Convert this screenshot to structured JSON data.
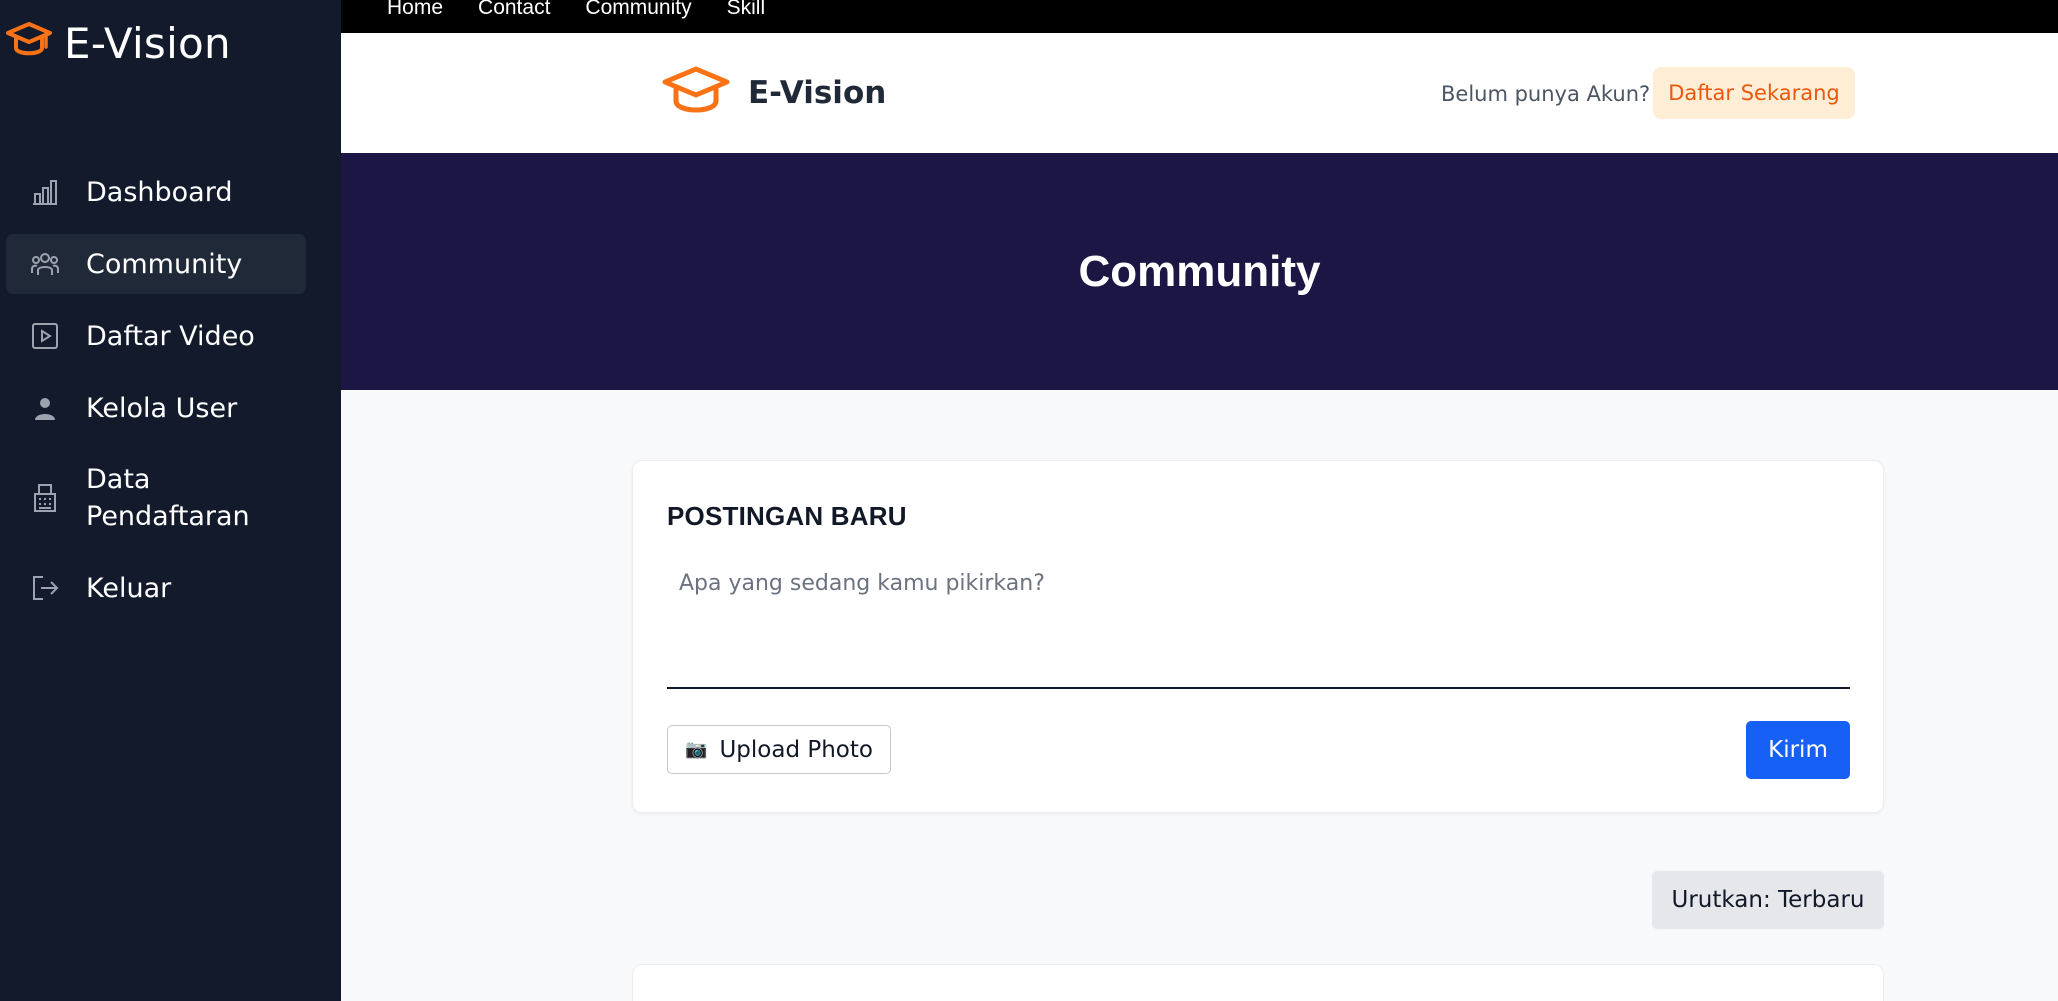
{
  "sidebar": {
    "brand": "E-Vision",
    "items": [
      {
        "label": "Dashboard",
        "icon": "chart-bar-icon"
      },
      {
        "label": "Community",
        "icon": "users-icon",
        "active": true
      },
      {
        "label": "Daftar Video",
        "icon": "video-play-icon"
      },
      {
        "label": "Kelola User",
        "icon": "user-icon"
      },
      {
        "label": "Data Pendaftaran",
        "icon": "register-icon"
      },
      {
        "label": "Keluar",
        "icon": "logout-icon"
      }
    ]
  },
  "topnav": {
    "links": [
      "Home",
      "Contact",
      "Community",
      "Skill"
    ]
  },
  "header": {
    "brand": "E-Vision",
    "account_prompt": "Belum punya Akun?",
    "register_button": "Daftar Sekarang"
  },
  "hero": {
    "title": "Community"
  },
  "post_form": {
    "title": "POSTINGAN BARU",
    "placeholder": "Apa yang sedang kamu pikirkan?",
    "value": "",
    "upload_icon": "📷",
    "upload_label": "Upload Photo",
    "send_label": "Kirim"
  },
  "sort": {
    "label": "Urutkan: Terbaru"
  },
  "colors": {
    "sidebar_bg": "#131a2b",
    "accent_orange": "#f97316",
    "hero_bg": "#1c1644",
    "primary_blue": "#1660f5"
  }
}
